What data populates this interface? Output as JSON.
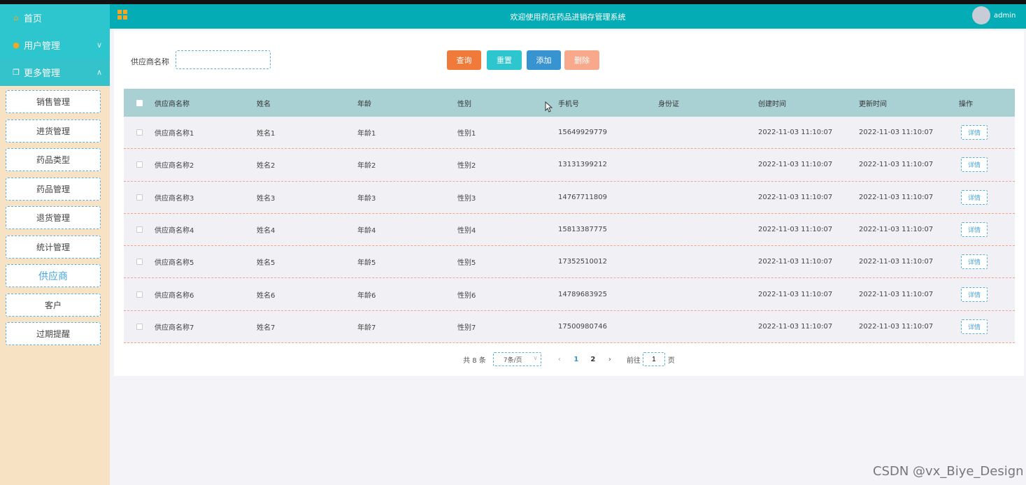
{
  "sidebar": {
    "home": "首页",
    "user_mgmt": "用户管理",
    "more_mgmt": "更多管理",
    "items": [
      {
        "label": "销售管理"
      },
      {
        "label": "进货管理"
      },
      {
        "label": "药品类型"
      },
      {
        "label": "药品管理"
      },
      {
        "label": "退货管理"
      },
      {
        "label": "统计管理"
      },
      {
        "label": "供应商"
      },
      {
        "label": "客户"
      },
      {
        "label": "过期提醒"
      }
    ]
  },
  "header": {
    "title": "欢迎使用药店药品进销存管理系统",
    "user": "admin",
    "color": "#04acb6"
  },
  "search": {
    "label": "供应商名称",
    "value": "",
    "buttons": {
      "query": "查询",
      "reset": "重置",
      "add": "添加",
      "delete": "删除"
    }
  },
  "table": {
    "headers": [
      "供应商名称",
      "姓名",
      "年龄",
      "性别",
      "手机号",
      "身份证",
      "创建时间",
      "更新时间",
      "操作"
    ],
    "rows": [
      {
        "supplier": "供应商名称1",
        "name": "姓名1",
        "age": "年龄1",
        "gender": "性别1",
        "phone": "15649929779",
        "idcard": "",
        "created": "2022-11-03 11:10:07",
        "updated": "2022-11-03 11:10:07",
        "action": "详情"
      },
      {
        "supplier": "供应商名称2",
        "name": "姓名2",
        "age": "年龄2",
        "gender": "性别2",
        "phone": "13131399212",
        "idcard": "",
        "created": "2022-11-03 11:10:07",
        "updated": "2022-11-03 11:10:07",
        "action": "详情"
      },
      {
        "supplier": "供应商名称3",
        "name": "姓名3",
        "age": "年龄3",
        "gender": "性别3",
        "phone": "14767711809",
        "idcard": "",
        "created": "2022-11-03 11:10:07",
        "updated": "2022-11-03 11:10:07",
        "action": "详情"
      },
      {
        "supplier": "供应商名称4",
        "name": "姓名4",
        "age": "年龄4",
        "gender": "性别4",
        "phone": "15813387775",
        "idcard": "",
        "created": "2022-11-03 11:10:07",
        "updated": "2022-11-03 11:10:07",
        "action": "详情"
      },
      {
        "supplier": "供应商名称5",
        "name": "姓名5",
        "age": "年龄5",
        "gender": "性别5",
        "phone": "17352510012",
        "idcard": "",
        "created": "2022-11-03 11:10:07",
        "updated": "2022-11-03 11:10:07",
        "action": "详情"
      },
      {
        "supplier": "供应商名称6",
        "name": "姓名6",
        "age": "年龄6",
        "gender": "性别6",
        "phone": "14789683925",
        "idcard": "",
        "created": "2022-11-03 11:10:07",
        "updated": "2022-11-03 11:10:07",
        "action": "详情"
      },
      {
        "supplier": "供应商名称7",
        "name": "姓名7",
        "age": "年龄7",
        "gender": "性别7",
        "phone": "17500980746",
        "idcard": "",
        "created": "2022-11-03 11:10:07",
        "updated": "2022-11-03 11:10:07",
        "action": "详情"
      }
    ]
  },
  "pagination": {
    "total": "共 8 条",
    "page_size": "7条/页",
    "pages": [
      "1",
      "2"
    ],
    "goto_label": "前往",
    "goto_value": "1",
    "page_unit": "页"
  },
  "watermark": "CSDN @vx_Biye_Design"
}
